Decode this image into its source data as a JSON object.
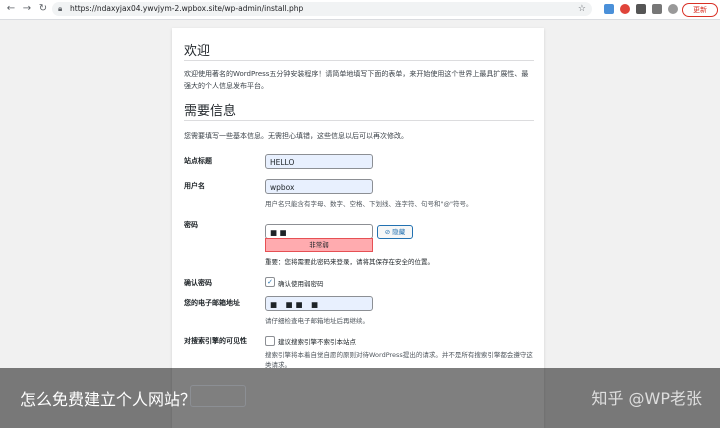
{
  "browser": {
    "url": "https://ndaxyjax04.ywvjym-2.wpbox.site/wp-admin/install.php",
    "update_label": "更新"
  },
  "install": {
    "welcome_heading": "欢迎",
    "welcome_text": "欢迎使用著名的WordPress五分钟安装程序！请简单地填写下面的表单，来开始使用这个世界上最具扩展性、最强大的个人信息发布平台。",
    "info_heading": "需要信息",
    "info_text": "您需要填写一些基本信息。无需担心填错，这些信息以后可以再次修改。",
    "site_title_label": "站点标题",
    "site_title_value": "HELLO",
    "username_label": "用户名",
    "username_value": "wpbox",
    "username_hint": "用户名只能含有字母、数字、空格、下划线、连字符、句号和\"@\"符号。",
    "password_label": "密码",
    "password_value": "■ ■",
    "hide_label": "隐藏",
    "strength_label": "非常弱",
    "important_note": "重要：您将需要此密码来登录，请将其保存在安全的位置。",
    "confirm_label": "确认密码",
    "confirm_checkbox_label": "确认使用弱密码",
    "email_label": "您的电子邮箱地址",
    "email_value": "■ ■■ ■",
    "email_hint": "请仔细检查电子邮箱地址后再继续。",
    "search_label": "对搜索引擎的可见性",
    "search_checkbox_label": "建议搜索引擎不索引本站点",
    "search_hint": "搜索引擎将本着自觉自愿的原则对待WordPress提出的请求。并不是所有搜索引擎都会遵守这类请求。"
  },
  "overlay": {
    "title": "怎么免费建立个人网站？",
    "watermark": "知乎 @WP老张"
  }
}
